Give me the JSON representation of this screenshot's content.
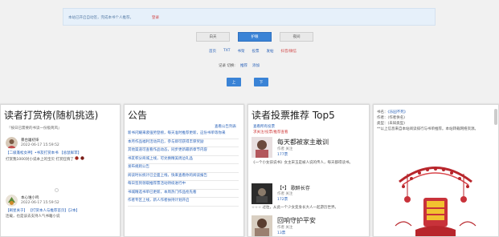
{
  "notice": {
    "text": "本站已开启自动签，完成本书个人推荐。",
    "link": "登录"
  },
  "themes": [
    {
      "label": "白天",
      "active": false
    },
    {
      "label": "护眼",
      "active": true
    },
    {
      "label": "夜间",
      "active": false
    }
  ],
  "nav_links": [
    {
      "label": "首页",
      "red": false
    },
    {
      "label": "TXT",
      "red": false
    },
    {
      "label": "书架",
      "red": false
    },
    {
      "label": "投票",
      "red": false
    },
    {
      "label": "发帖",
      "red": false
    },
    {
      "label": "抖音/微信",
      "red": true
    }
  ],
  "memory": {
    "label": "记录 切换:",
    "link1": "推荐",
    "link2": "添加"
  },
  "actions": {
    "prev": "上",
    "next": "下"
  },
  "panel_reward": {
    "title": "读者打赏榜(随机挑选)",
    "note": "『按日已需要的书读一份极简风』",
    "items": [
      {
        "user": "暴台屠初柒",
        "time": "2022-06-17 15:59:52",
        "line1": "【二级蓬松女神】•书友打赏本书 【总鼠鲜苹】",
        "line2": "打赏我1000对小说本上的宝贝 打赏狂情了"
      },
      {
        "user": "本心谁小鸣",
        "time": "2022-06-17 15:59:52",
        "line1": "【刷星关于】 【打赏本人与推荐首页】【2本】",
        "line2": "连载，也是该去支持人气书籍小说"
      }
    ]
  },
  "panel_notice": {
    "title": "公告",
    "more": "查看公告列表",
    "items": [
      "新书闪耀来袭强势登榜，每天准时推荐更新，这份书单等你来",
      "本月作品福利活动开启，参与即可获得丰厚奖励",
      "其他渠道可查看作品动态，同步更新最新章节内容",
      "书友积分商城上线，可兑换精美周边礼品",
      "发布规则公告",
      "阅读时长统计已全面上线，快来查看你的阅读报告",
      "每日签到领取推荐票活动持续进行中",
      "书城精选书单已更新，本周热门作品抢先看",
      "作者专区上线，新人作者扶持计划开启"
    ]
  },
  "panel_vote": {
    "title": "读者投票推荐 Top5",
    "links": [
      "查看所有投票",
      "求关注/投票/推荐查看"
    ],
    "books": [
      {
        "title": "每天都被家主敢训",
        "meta": "作者  关注",
        "votes": "177票",
        "desc": "《一个小女孩说书》女主宋玉是被人说的传人，每天都得读书。"
      },
      {
        "title": "【*】 歌醉长存",
        "meta": "作者  关注",
        "votes": "172票",
        "desc": "☆☆☆ 过往，从此一个少女变身长大人一起游历世界。"
      },
      {
        "title": "回响守护平安",
        "meta": "作者  关注",
        "votes": "13票",
        "desc": ""
      }
    ]
  },
  "panel_book": {
    "lines": [
      {
        "label": "书名：",
        "value": "《乐园不死》"
      },
      {
        "label": "作者：",
        "value": "(作者佚名)"
      },
      {
        "label": "类型：",
        "value": "(未知类型)"
      },
      {
        "label": "",
        "value": "**以上信息来自本站阅读排行与书单推荐。本站转载网络资源。"
      }
    ]
  },
  "colors": {
    "accent": "#3a83d6",
    "link": "#2a62b8",
    "alert": "#d04040"
  }
}
